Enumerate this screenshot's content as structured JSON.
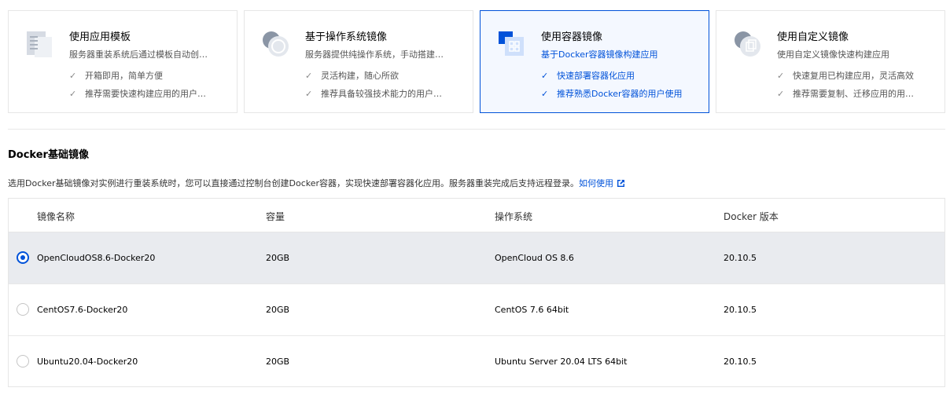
{
  "cards": [
    {
      "title": "使用应用模板",
      "desc": "服务器重装系统后通过模板自动创…",
      "features": [
        "开箱即用，简单方便",
        "推荐需要快速构建应用的用户…"
      ],
      "icon": "app-template-icon"
    },
    {
      "title": "基于操作系统镜像",
      "desc": "服务器提供纯操作系统，手动搭建…",
      "features": [
        "灵活构建，随心所欲",
        "推荐具备较强技术能力的用户…"
      ],
      "icon": "os-image-icon"
    },
    {
      "title": "使用容器镜像",
      "desc": "基于Docker容器镜像构建应用",
      "features": [
        "快速部署容器化应用",
        "推荐熟悉Docker容器的用户使用"
      ],
      "icon": "container-image-icon",
      "selected": true
    },
    {
      "title": "使用自定义镜像",
      "desc": "使用自定义镜像快速构建应用",
      "features": [
        "快速复用已构建应用，灵活高效",
        "推荐需要复制、迁移应用的用…"
      ],
      "icon": "custom-image-icon"
    }
  ],
  "section": {
    "title": "Docker基础镜像",
    "desc": "选用Docker基础镜像对实例进行重装系统时，您可以直接通过控制台创建Docker容器，实现快速部署容器化应用。服务器重装完成后支持远程登录。",
    "link": "如何使用"
  },
  "table": {
    "headers": [
      "镜像名称",
      "容量",
      "操作系统",
      "Docker 版本"
    ],
    "rows": [
      {
        "name": "OpenCloudOS8.6-Docker20",
        "size": "20GB",
        "os": "OpenCloud OS 8.6",
        "docker": "20.10.5",
        "selected": true
      },
      {
        "name": "CentOS7.6-Docker20",
        "size": "20GB",
        "os": "CentOS 7.6 64bit",
        "docker": "20.10.5",
        "selected": false
      },
      {
        "name": "Ubuntu20.04-Docker20",
        "size": "20GB",
        "os": "Ubuntu Server 20.04 LTS 64bit",
        "docker": "20.10.5",
        "selected": false
      }
    ]
  },
  "colors": {
    "accent": "#0052d9",
    "selected_row": "#e9ebef",
    "selected_card_bg": "#f4f8ff"
  }
}
